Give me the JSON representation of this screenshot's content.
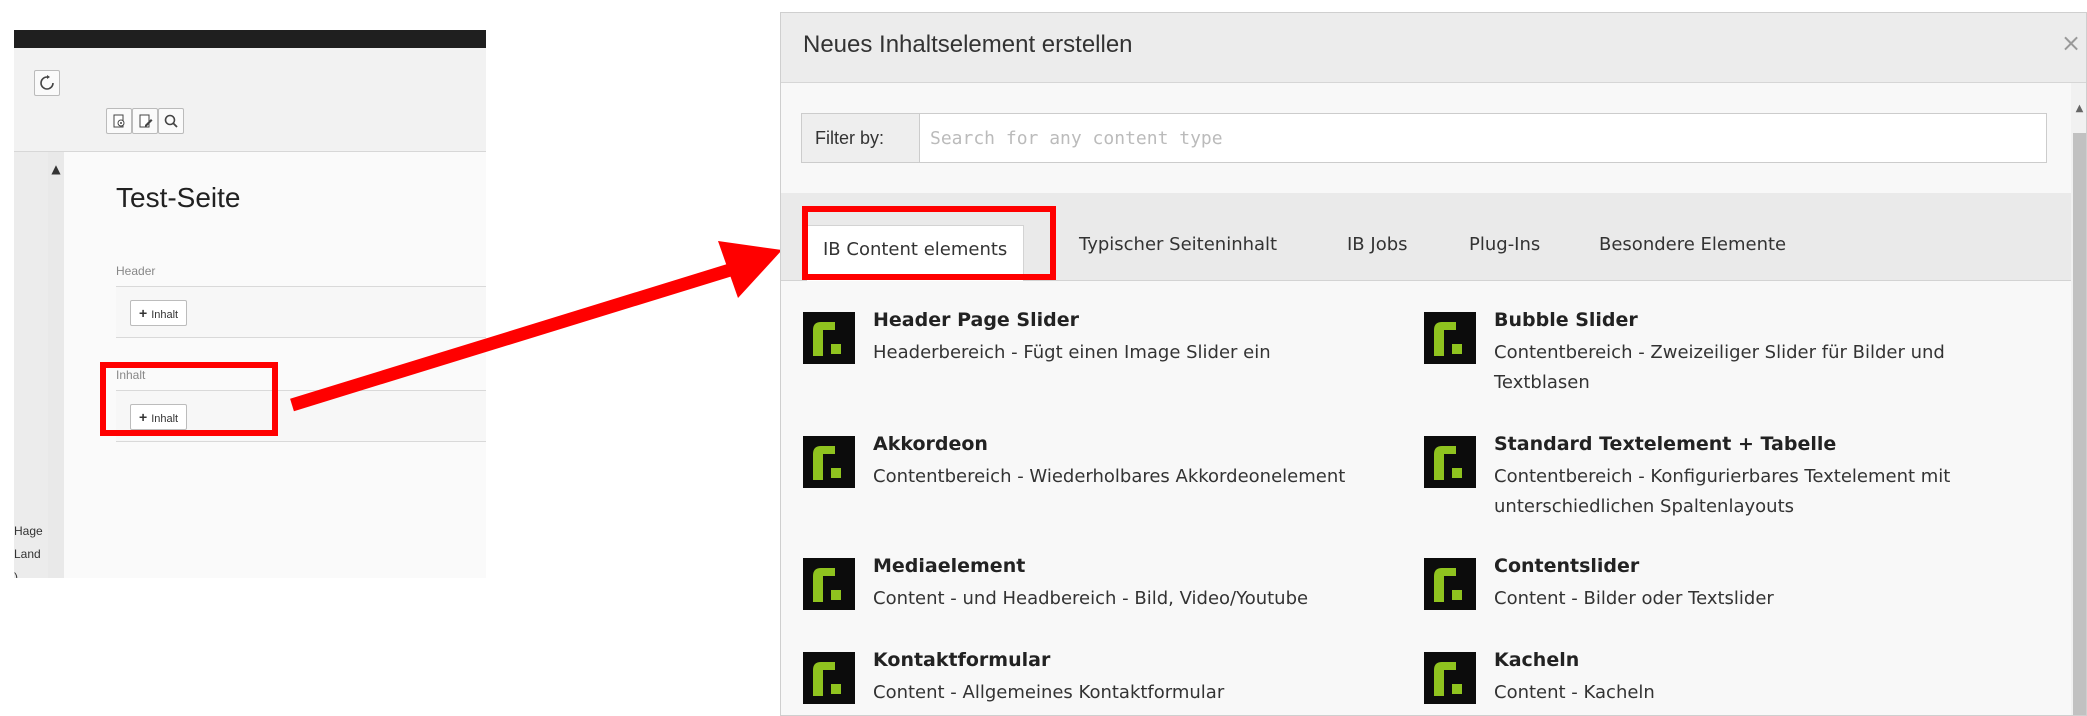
{
  "left_panel": {
    "refresh_icon": "refresh-icon",
    "toolbar_icons": [
      "view-page-icon",
      "edit-page-icon",
      "search-icon"
    ],
    "page_title": "Test-Seite",
    "sections": [
      {
        "label": "Header",
        "button_label": "Inhalt"
      },
      {
        "label": "Inhalt",
        "button_label": "Inhalt"
      }
    ],
    "side_texts": [
      "Hage",
      "Land",
      ")"
    ]
  },
  "modal": {
    "title": "Neues Inhaltselement erstellen",
    "close_label": "×",
    "filter": {
      "addon_label": "Filter by:",
      "placeholder": "Search for any content type",
      "value": ""
    },
    "tabs": [
      {
        "label": "IB Content elements",
        "active": true
      },
      {
        "label": "Typischer Seiteninhalt",
        "active": false
      },
      {
        "label": "IB Jobs",
        "active": false
      },
      {
        "label": "Plug-Ins",
        "active": false
      },
      {
        "label": "Besondere Elemente",
        "active": false
      }
    ],
    "elements": [
      {
        "title": "Header Page Slider",
        "description": "Headerbereich - Fügt einen Image Slider ein"
      },
      {
        "title": "Bubble Slider",
        "description": "Contentbereich - Zweizeiliger Slider für Bilder und Textblasen"
      },
      {
        "title": "Akkordeon",
        "description": "Contentbereich - Wiederholbares Akkordeonelement"
      },
      {
        "title": "Standard Textelement + Tabelle",
        "description": "Contentbereich - Konfigurierbares Textelement mit unterschiedlichen Spaltenlayouts"
      },
      {
        "title": "Mediaelement",
        "description": "Content - und Headbereich - Bild, Video/Youtube"
      },
      {
        "title": "Contentslider",
        "description": "Content - Bilder oder Textslider"
      },
      {
        "title": "Kontaktformular",
        "description": "Content - Allgemeines Kontaktformular"
      },
      {
        "title": "Kacheln",
        "description": "Content - Kacheln"
      }
    ],
    "element_icon": "content-element-icon"
  },
  "annotation": {
    "highlight_color": "#ff0000",
    "arrow_color": "#ff0000"
  }
}
